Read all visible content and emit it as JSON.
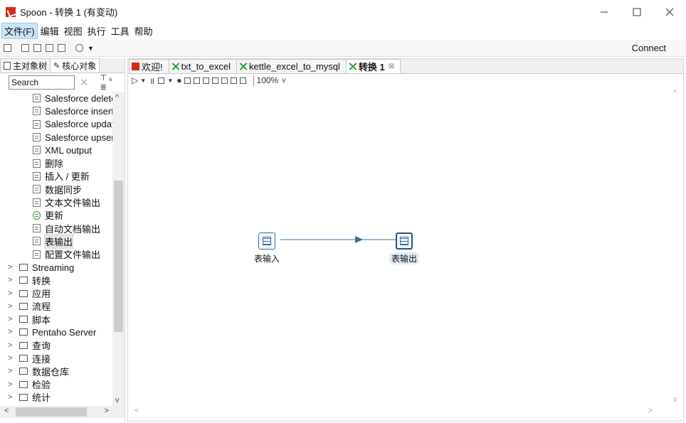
{
  "window": {
    "title": "Spoon - 转换 1 (有变动)",
    "minimize": "—",
    "close": "✕"
  },
  "menu": [
    {
      "label": "文件(F)",
      "active": true
    },
    {
      "label": "编辑"
    },
    {
      "label": "视图"
    },
    {
      "label": "执行"
    },
    {
      "label": "工具"
    },
    {
      "label": "帮助"
    }
  ],
  "toolbar": {
    "connect_label": "Connect"
  },
  "left_panel": {
    "tabs": [
      {
        "label": "主对象树"
      },
      {
        "label": "核心对象"
      }
    ],
    "search": {
      "value": "Search",
      "clear": "✕",
      "tools": "⊤₆ ≣"
    },
    "tree_children": [
      "Salesforce delete",
      "Salesforce insert",
      "Salesforce update",
      "Salesforce upsert",
      "XML output",
      "删除",
      "插入 / 更新",
      "数据同步",
      "文本文件输出",
      "更新",
      "自动文档输出",
      "表输出",
      "配置文件输出"
    ],
    "selected_child": "表输出",
    "tree_folders": [
      "Streaming",
      "转换",
      "应用",
      "流程",
      "脚本",
      "Pentaho Server",
      "查询",
      "连接",
      "数据仓库",
      "检验",
      "统计"
    ]
  },
  "editor": {
    "tabs": [
      {
        "label": "欢迎!",
        "icon": "welcome-icon"
      },
      {
        "label": "txt_to_excel",
        "icon": "transformation-icon"
      },
      {
        "label": "kettle_excel_to_mysql",
        "icon": "transformation-icon"
      },
      {
        "label": "转换 1",
        "icon": "transformation-icon",
        "selected": true,
        "close": "⊠"
      }
    ],
    "zoom": "100%",
    "steps": [
      {
        "name": "表输入",
        "type": "table-input"
      },
      {
        "name": "表输出",
        "type": "table-output"
      }
    ]
  }
}
